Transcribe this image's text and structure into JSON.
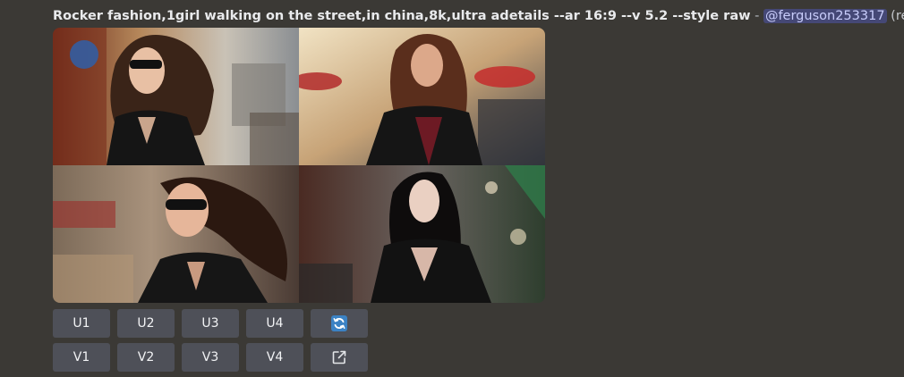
{
  "message": {
    "prompt": "Rocker fashion,1girl walking on the street,in china,8k,ultra adetails --ar 16:9 --v 5.2 --style raw",
    "separator": " - ",
    "mention": "@ferguson253317",
    "mode": "(relaxed)"
  },
  "image_grid": {
    "tiles": [
      {
        "subject": "woman-sunglasses-leather-jacket"
      },
      {
        "subject": "woman-red-top-leather-jacket"
      },
      {
        "subject": "woman-sunglasses-windblown-hair"
      },
      {
        "subject": "woman-black-hair-leather-jacket"
      }
    ]
  },
  "buttons": {
    "upscale": [
      "U1",
      "U2",
      "U3",
      "U4"
    ],
    "variation": [
      "V1",
      "V2",
      "V3",
      "V4"
    ],
    "reroll_icon": "refresh-icon",
    "web_icon": "external-link-icon"
  },
  "colors": {
    "background": "#3b3935",
    "button": "#4e5058",
    "reroll_accent": "#3b82c4",
    "mention_bg": "#5865f2"
  }
}
